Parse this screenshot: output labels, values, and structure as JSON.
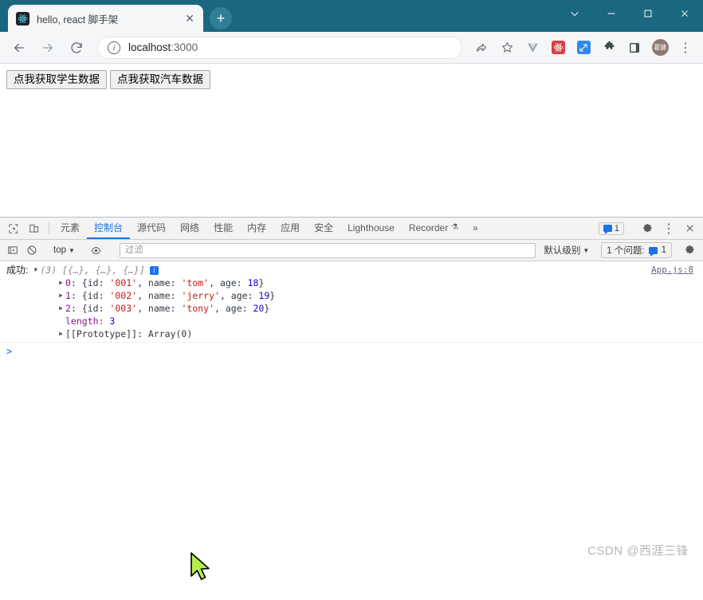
{
  "window": {
    "titlebar_color": "#1a6880",
    "controls": {
      "chevron": "chevron-down",
      "minimize": "–",
      "maximize": "□",
      "close": "✕"
    }
  },
  "tab": {
    "title": "hello, react 脚手架",
    "favicon": "react-logo-icon",
    "close_label": "✕",
    "newtab_label": "+"
  },
  "toolbar": {
    "back": "←",
    "forward": "→",
    "reload": "⟳",
    "url_host": "localhost",
    "url_port": ":3000",
    "site_info": "ⓘ",
    "share": "share-icon",
    "bookmark": "☆",
    "ext_vue": "V",
    "ext_react": "react-devtools-icon",
    "ext_blue": "screenshot-icon",
    "ext_puzzle": "extensions-icon",
    "sidepanel": "side-panel-icon",
    "avatar_initials": "霍健",
    "menu": "⋮"
  },
  "page": {
    "buttons": [
      {
        "label": "点我获取学生数据"
      },
      {
        "label": "点我获取汽车数据"
      }
    ]
  },
  "devtools": {
    "tabs": [
      {
        "label": "元素",
        "active": false
      },
      {
        "label": "控制台",
        "active": true
      },
      {
        "label": "源代码",
        "active": false
      },
      {
        "label": "网络",
        "active": false
      },
      {
        "label": "性能",
        "active": false
      },
      {
        "label": "内存",
        "active": false
      },
      {
        "label": "应用",
        "active": false
      },
      {
        "label": "安全",
        "active": false
      },
      {
        "label": "Lighthouse",
        "active": false
      },
      {
        "label": "Recorder",
        "active": false
      }
    ],
    "recorder_suffix": "⚗",
    "more_tabs": "»",
    "message_count": "1",
    "settings": "gear-icon",
    "more_options": "⋮",
    "close": "✕",
    "inspect_icon": "inspect-element-icon",
    "device_icon": "device-toolbar-icon"
  },
  "console": {
    "sidebar_toggle": "▣",
    "clear": "🚫",
    "context": "top",
    "context_caret": "▼",
    "eye": "live-expression-icon",
    "filter_placeholder": "过滤",
    "filter_value": "",
    "level": "默认级别",
    "level_caret": "▼",
    "issues_label": "1 个问题:",
    "issues_count": "1",
    "settings": "gear-icon",
    "prompt": ">"
  },
  "log": {
    "label": "成功:",
    "expand_caret": "▼",
    "array_preview": "(3) [{…}, {…}, {…}]",
    "info_badge": "i",
    "source": "App.js:8",
    "child_caret": "▶",
    "items": [
      {
        "index": "0",
        "id_key": "{id:",
        "id_value": "'001'",
        "name_key": ", name:",
        "name_value": "'tom'",
        "age_key": ", age:",
        "age_value": "18",
        "close": "}"
      },
      {
        "index": "1",
        "id_key": "{id:",
        "id_value": "'002'",
        "name_key": ", name:",
        "name_value": "'jerry'",
        "age_key": ", age:",
        "age_value": "19",
        "close": "}"
      },
      {
        "index": "2",
        "id_key": "{id:",
        "id_value": "'003'",
        "name_key": ", name:",
        "name_value": "'tony'",
        "age_key": ", age:",
        "age_value": "20",
        "close": "}"
      }
    ],
    "length_key": "length:",
    "length_value": "3",
    "prototype_key": "[[Prototype]]:",
    "prototype_value": "Array(0)"
  },
  "watermark": "CSDN @西涯三锋"
}
